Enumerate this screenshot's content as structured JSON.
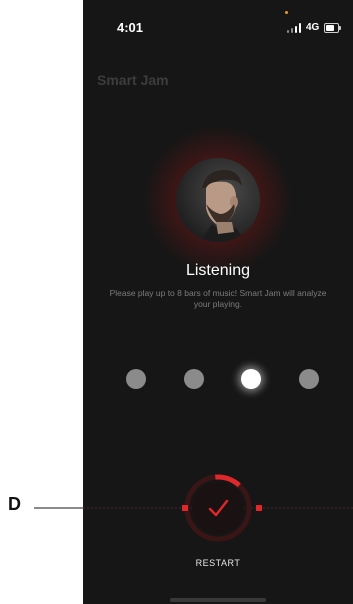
{
  "status_bar": {
    "time": "4:01",
    "network": "4G",
    "icons": [
      "signal-icon",
      "battery-icon"
    ]
  },
  "app": {
    "title": "Smart Jam"
  },
  "listening": {
    "heading": "Listening",
    "description": "Please play up to 8 bars of music! Smart Jam will analyze your playing."
  },
  "progress_dots": {
    "count": 4,
    "active_index": 2
  },
  "controls": {
    "restart_label": "RESTART",
    "confirm_icon": "checkmark-icon"
  },
  "annotation": {
    "label": "D"
  },
  "colors": {
    "background": "#161616",
    "accent": "#e0282a",
    "dot_inactive": "#8b8b8b",
    "dot_active": "#ffffff"
  }
}
